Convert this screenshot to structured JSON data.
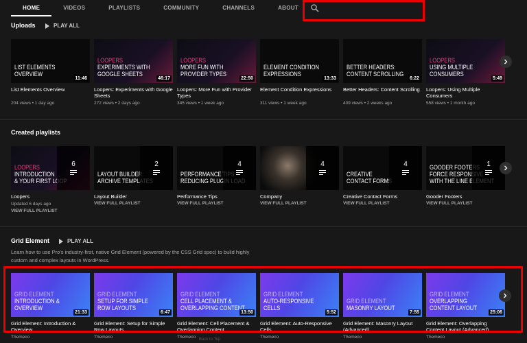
{
  "tabs": [
    "HOME",
    "VIDEOS",
    "PLAYLISTS",
    "COMMUNITY",
    "CHANNELS",
    "ABOUT"
  ],
  "uploads": {
    "title": "Uploads",
    "play_all": "PLAY ALL",
    "items": [
      {
        "thumb_text": [
          "List Elements",
          "Overview"
        ],
        "thumb_style": "plain",
        "duration": "11:46",
        "title": "List Elements Overview",
        "meta": "204 views • 1 day ago"
      },
      {
        "thumb_text": [
          "Loopers",
          "Experiments With",
          "Google Sheets"
        ],
        "thumb_style": "loopers",
        "duration": "46:17",
        "title": "Loopers: Experiments with Google Sheets",
        "meta": "272 views • 2 days ago"
      },
      {
        "thumb_text": [
          "Loopers",
          "More Fun With",
          "Provider Types"
        ],
        "thumb_style": "loopers",
        "duration": "22:50",
        "title": "Loopers: More Fun with Provider Types",
        "meta": "345 views • 1 week ago"
      },
      {
        "thumb_text": [
          "Element Condition",
          "Expressions"
        ],
        "thumb_style": "plain",
        "duration": "13:33",
        "title": "Element Condition Expressions",
        "meta": "311 views • 1 week ago"
      },
      {
        "thumb_text": [
          "Better Headers:",
          "Content Scrolling"
        ],
        "thumb_style": "plain",
        "duration": "6:22",
        "title": "Better Headers: Content Scrolling",
        "meta": "409 views • 2 weeks ago"
      },
      {
        "thumb_text": [
          "Loopers",
          "Using Multiple",
          "Consumers"
        ],
        "thumb_style": "loopers",
        "duration": "5:49",
        "title": "Loopers: Using Multiple Consumers",
        "meta": "558 views • 1 month ago"
      }
    ]
  },
  "playlists": {
    "title": "Created playlists",
    "items": [
      {
        "thumb_text": [
          "Loopers",
          "Introduction",
          "& Your First Loop"
        ],
        "thumb_style": "loopers",
        "count": "6",
        "title": "Loopers",
        "meta": "Updated 6 days ago",
        "link": "VIEW FULL PLAYLIST"
      },
      {
        "thumb_text": [
          "Layout Builder:",
          "Archive Templates"
        ],
        "thumb_style": "plain",
        "count": "2",
        "title": "Layout Builder",
        "meta": "",
        "link": "VIEW FULL PLAYLIST"
      },
      {
        "thumb_text": [
          "Performance Tips:",
          "Reducing Plugin Load"
        ],
        "thumb_style": "plain",
        "count": "4",
        "title": "Performance Tips",
        "meta": "",
        "link": "VIEW FULL PLAYLIST"
      },
      {
        "thumb_text": [],
        "thumb_style": "photo",
        "count": "4",
        "title": "Company",
        "meta": "",
        "link": "VIEW FULL PLAYLIST"
      },
      {
        "thumb_text": [
          "Creative",
          "Contact Forms"
        ],
        "thumb_style": "plain",
        "count": "4",
        "title": "Creative Contact Forms",
        "meta": "",
        "link": "VIEW FULL PLAYLIST"
      },
      {
        "thumb_text": [
          "Gooder Footers",
          "Force Responsive",
          "with the Line Element"
        ],
        "thumb_style": "plain",
        "count": "1",
        "title": "Gooder Footers",
        "meta": "",
        "link": "VIEW FULL PLAYLIST"
      }
    ]
  },
  "grid": {
    "title": "Grid Element",
    "play_all": "PLAY ALL",
    "description": "Learn how to use Pro's industry-first, native Grid Element (powered by the CSS Grid spec) to build highly custom and complex layouts in WordPress.",
    "items": [
      {
        "thumb_text": [
          "Grid Element",
          "Introduction &",
          "Overview"
        ],
        "duration": "21:33",
        "title": "Grid Element: Introduction & Overview",
        "meta": "Themeco"
      },
      {
        "thumb_text": [
          "Grid Element",
          "Setup for Simple",
          "Row Layouts"
        ],
        "duration": "6:47",
        "title": "Grid Element: Setup for Simple Row Layouts",
        "meta": "Themeco"
      },
      {
        "thumb_text": [
          "Grid Element",
          "Cell Placement &",
          "Overlapping Content"
        ],
        "duration": "13:50",
        "title": "Grid Element: Cell Placement & Overlapping Content",
        "meta": "Themeco"
      },
      {
        "thumb_text": [
          "Grid Element",
          "Auto-Responsive",
          "Cells"
        ],
        "duration": "5:52",
        "title": "Grid Element: Auto-Responsive Cells",
        "meta": "Themeco"
      },
      {
        "thumb_text": [
          "Grid Element",
          "Masonry Layout"
        ],
        "duration": "7:55",
        "title": "Grid Element: Masonry Layout (Advanced)",
        "meta": "Themeco"
      },
      {
        "thumb_text": [
          "Grid Element",
          "Overlapping",
          "Content Layout"
        ],
        "duration": "25:06",
        "title": "Grid Element: Overlapping Content Layout (Advanced)",
        "meta": "Themeco"
      }
    ]
  },
  "footer_hint": "Back to Top",
  "colors": {
    "accent_red": "#e00000",
    "looper_pink": "#e0457b",
    "grid_blue": "#3b82f6",
    "grid_purple": "#7c3aed"
  },
  "icons": {
    "search": "search-icon",
    "next": "chevron-right-icon",
    "playlist": "playlist-icon",
    "play": "play-icon"
  }
}
